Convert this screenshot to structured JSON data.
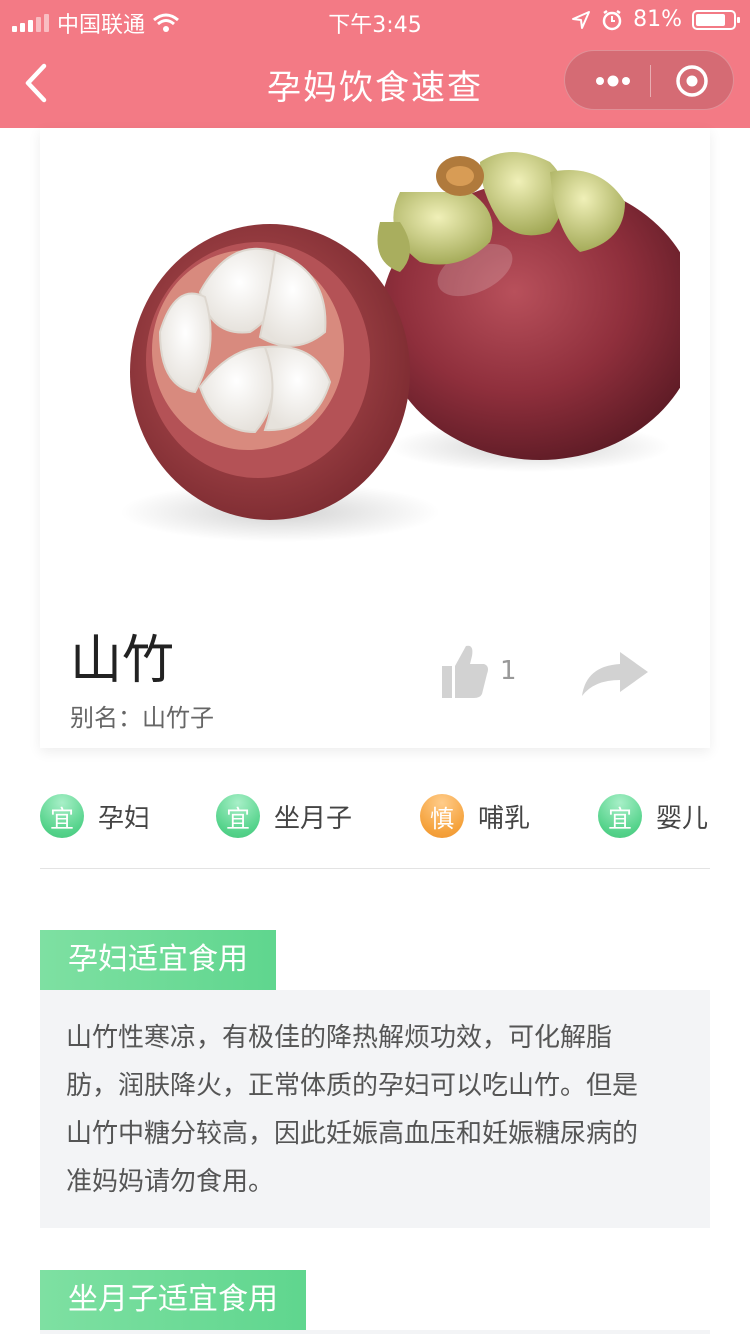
{
  "status_bar": {
    "carrier": "中国联通",
    "time": "下午3:45",
    "battery": "81%",
    "battery_level": 0.81
  },
  "nav": {
    "title": "孕妈饮食速查"
  },
  "food": {
    "name": "山竹",
    "alias_label": "别名：",
    "alias": "山竹子",
    "like_count": "1"
  },
  "tags": [
    {
      "badge": "宜",
      "label": "孕妇",
      "color": "#5dd38f"
    },
    {
      "badge": "宜",
      "label": "坐月子",
      "color": "#5dd38f"
    },
    {
      "badge": "慎",
      "label": "哺乳",
      "color": "#f5a23c"
    },
    {
      "badge": "宜",
      "label": "婴儿",
      "color": "#5dd38f"
    }
  ],
  "sections": [
    {
      "title": "孕妇适宜食用",
      "lines": [
        "山竹性寒凉，有极佳的降热解烦功效，可化解脂",
        "肪，润肤降火，正常体质的孕妇可以吃山竹。但是",
        "山竹中糖分较高，因此妊娠高血压和妊娠糖尿病的",
        "准妈妈请勿食用。"
      ]
    },
    {
      "title": "坐月子适宜食用"
    }
  ],
  "colors": {
    "nav": "#f37a85",
    "green": "#5dd38f",
    "orange": "#f5a23c"
  },
  "icons": [
    "signal-icon",
    "wifi-icon",
    "location-icon",
    "alarm-icon",
    "battery-icon",
    "back-arrow-icon",
    "more-dots-icon",
    "target-icon",
    "thumbs-up-icon",
    "share-arrow-icon"
  ]
}
